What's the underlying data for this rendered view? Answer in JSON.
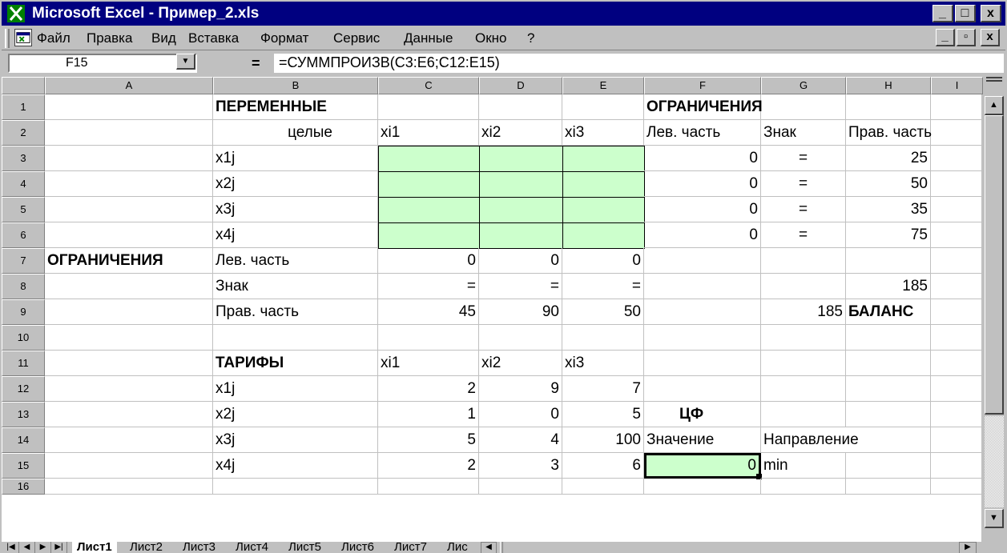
{
  "window": {
    "title": "Microsoft Excel - Пример_2.xls",
    "controls": [
      "_",
      "□",
      "x"
    ]
  },
  "menu": {
    "items": [
      "Файл",
      "Правка",
      "Вид",
      "Вставка",
      "Формат",
      "Сервис",
      "Данные",
      "Окно",
      "?"
    ],
    "doc_controls": [
      "_",
      "▫",
      "x"
    ]
  },
  "formula_bar": {
    "name_box": "F15",
    "equals": "=",
    "formula": "=СУММПРОИЗВ(C3:E6;C12:E15)"
  },
  "columns": [
    "A",
    "B",
    "C",
    "D",
    "E",
    "F",
    "G",
    "H",
    "I"
  ],
  "rows": [
    "1",
    "2",
    "3",
    "4",
    "5",
    "6",
    "7",
    "8",
    "9",
    "10",
    "11",
    "12",
    "13",
    "14",
    "15",
    "16"
  ],
  "cells": {
    "B1": "ПЕРЕМЕННЫЕ",
    "F1": "ОГРАНИЧЕНИЯ",
    "B2": "целые",
    "C2": "xi1",
    "D2": "xi2",
    "E2": "xi3",
    "F2": "Лев. часть",
    "G2": "Знак",
    "H2": "Прав. часть",
    "B3": "x1j",
    "F3": "0",
    "G3": "=",
    "H3": "25",
    "B4": "x2j",
    "F4": "0",
    "G4": "=",
    "H4": "50",
    "B5": "x3j",
    "F5": "0",
    "G5": "=",
    "H5": "35",
    "B6": "x4j",
    "F6": "0",
    "G6": "=",
    "H6": "75",
    "A7": "ОГРАНИЧЕНИЯ",
    "B7": "Лев. часть",
    "C7": "0",
    "D7": "0",
    "E7": "0",
    "B8": "Знак",
    "C8": "=",
    "D8": "=",
    "E8": "=",
    "H8": "185",
    "B9": "Прав. часть",
    "C9": "45",
    "D9": "90",
    "E9": "50",
    "G9": "185",
    "H9": "БАЛАНС",
    "B11": "ТАРИФЫ",
    "C11": "xi1",
    "D11": "xi2",
    "E11": "xi3",
    "B12": "x1j",
    "C12": "2",
    "D12": "9",
    "E12": "7",
    "B13": "x2j",
    "C13": "1",
    "D13": "0",
    "E13": "5",
    "F13": "ЦФ",
    "B14": "x3j",
    "C14": "5",
    "D14": "4",
    "E14": "100",
    "F14": "Значение",
    "G14": "Направление",
    "B15": "x4j",
    "C15": "2",
    "D15": "3",
    "E15": "6",
    "F15": "0",
    "G15": "min"
  },
  "sheet_tabs": [
    "Лист1",
    "Лист2",
    "Лист3",
    "Лист4",
    "Лист5",
    "Лист6",
    "Лист7",
    "Лис"
  ],
  "active_tab": "Лист1",
  "colors": {
    "title_bg": "#000080",
    "cell_highlight": "#ccffcc",
    "chrome": "#c0c0c0"
  }
}
